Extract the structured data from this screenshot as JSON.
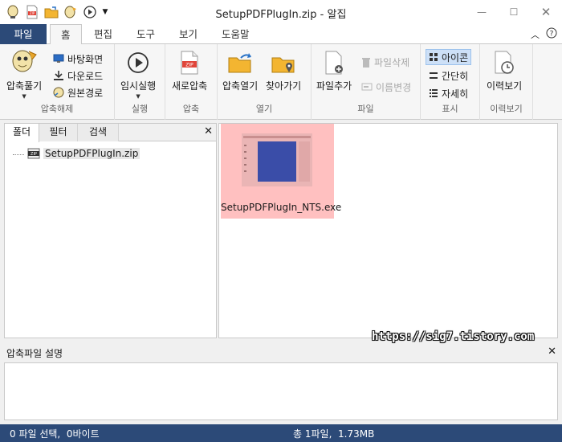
{
  "window": {
    "title": "SetupPDFPlugIn.zip - 알집",
    "controls": [
      "minimize",
      "maximize",
      "close"
    ]
  },
  "qat_icons": [
    "app-logo-icon",
    "new-zip-icon",
    "open-folder-icon",
    "extract-icon",
    "play-icon",
    "qat-menu-icon"
  ],
  "tabs": {
    "file": "파일",
    "items": [
      "홈",
      "편집",
      "도구",
      "보기",
      "도움말"
    ],
    "active": "홈"
  },
  "ribbon": {
    "groups": {
      "extract": {
        "label": "압축해제",
        "big": "압축풀기",
        "small": [
          "바탕화면",
          "다운로드",
          "원본경로"
        ]
      },
      "run": {
        "label": "실행",
        "big": "임시실행"
      },
      "compress": {
        "label": "압축",
        "big": "새로압축"
      },
      "open": {
        "label": "열기",
        "big1": "압축열기",
        "big2": "찾아가기"
      },
      "file": {
        "label": "파일",
        "big": "파일추가",
        "small": [
          "파일삭제",
          "이름변경"
        ]
      },
      "view": {
        "label": "표시",
        "small": [
          "아이콘",
          "간단히",
          "자세히"
        ],
        "selected": "아이콘"
      },
      "history": {
        "label": "이력보기",
        "big": "이력보기"
      }
    }
  },
  "left_pane": {
    "tabs": [
      "폴더",
      "필터",
      "검색"
    ],
    "active_tab": "폴더",
    "tree": [
      "SetupPDFPlugIn.zip"
    ]
  },
  "files": [
    {
      "name": "SetupPDFPlugIn_NTS.exe",
      "selected": true
    }
  ],
  "watermark": "https://sig7.tistory.com",
  "description_pane": {
    "title": "압축파일 설명",
    "content": ""
  },
  "status": {
    "left": "0 파일 선택,  0바이트",
    "right": "총 1파일,  1.73MB"
  },
  "colors": {
    "accent": "#2c4a78",
    "selection": "#ffc0c0",
    "view_selected": "#cde0f7"
  }
}
